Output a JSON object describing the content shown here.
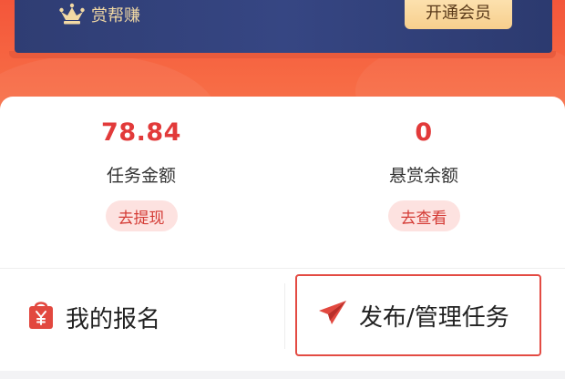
{
  "vip": {
    "brand_label": "赏帮赚",
    "crown_icon": "crown-icon",
    "open_vip_label": "开通会员",
    "banner_color": "#2f3d73",
    "button_color": "#f7cf8d"
  },
  "balances": {
    "task_amount": {
      "value": "78.84",
      "label": "任务金额",
      "action_label": "去提现"
    },
    "reward_balance": {
      "value": "0",
      "label": "悬赏余额",
      "action_label": "去查看"
    }
  },
  "actions": {
    "my_signups": {
      "label": "我的报名",
      "icon": "bag-icon"
    },
    "publish_manage": {
      "label": "发布/管理任务",
      "icon": "paper-plane-icon"
    }
  },
  "colors": {
    "accent_red": "#e23a3a",
    "header_orange": "#f3563a",
    "pill_bg": "#fde2e0"
  }
}
